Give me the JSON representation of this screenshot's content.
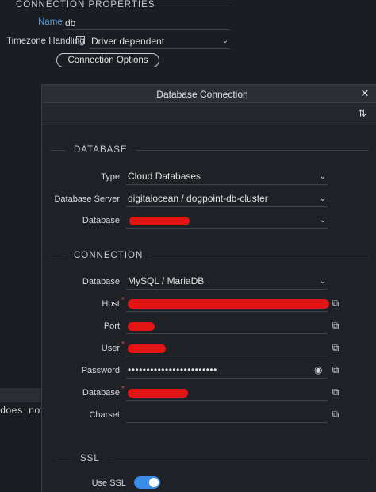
{
  "properties": {
    "section_title": "CONNECTION PROPERTIES",
    "name_label": "Name",
    "name_value": "db",
    "timezone_label": "Timezone Handling",
    "timezone_value": "Driver dependent",
    "connection_options_button": "Connection Options"
  },
  "background_text": "does not",
  "dialog": {
    "title": "Database Connection",
    "close": "✕",
    "database_section": {
      "heading": "DATABASE",
      "type_label": "Type",
      "type_value": "Cloud Databases",
      "server_label": "Database Server",
      "server_value": "digitalocean / dogpoint-db-cluster",
      "database_label": "Database"
    },
    "connection_section": {
      "heading": "CONNECTION",
      "database_label": "Database",
      "database_value": "MySQL / MariaDB",
      "host_label": "Host",
      "port_label": "Port",
      "user_label": "User",
      "password_label": "Password",
      "password_value": "••••••••••••••••••••••••",
      "db_label": "Database",
      "charset_label": "Charset",
      "required_mark": "*"
    },
    "ssl_section": {
      "heading": "SSL",
      "use_ssl_label": "Use SSL",
      "use_ssl_enabled": true
    }
  },
  "colors": {
    "accent": "#3a8de8",
    "redaction": "#e21414",
    "required": "#e04040"
  }
}
